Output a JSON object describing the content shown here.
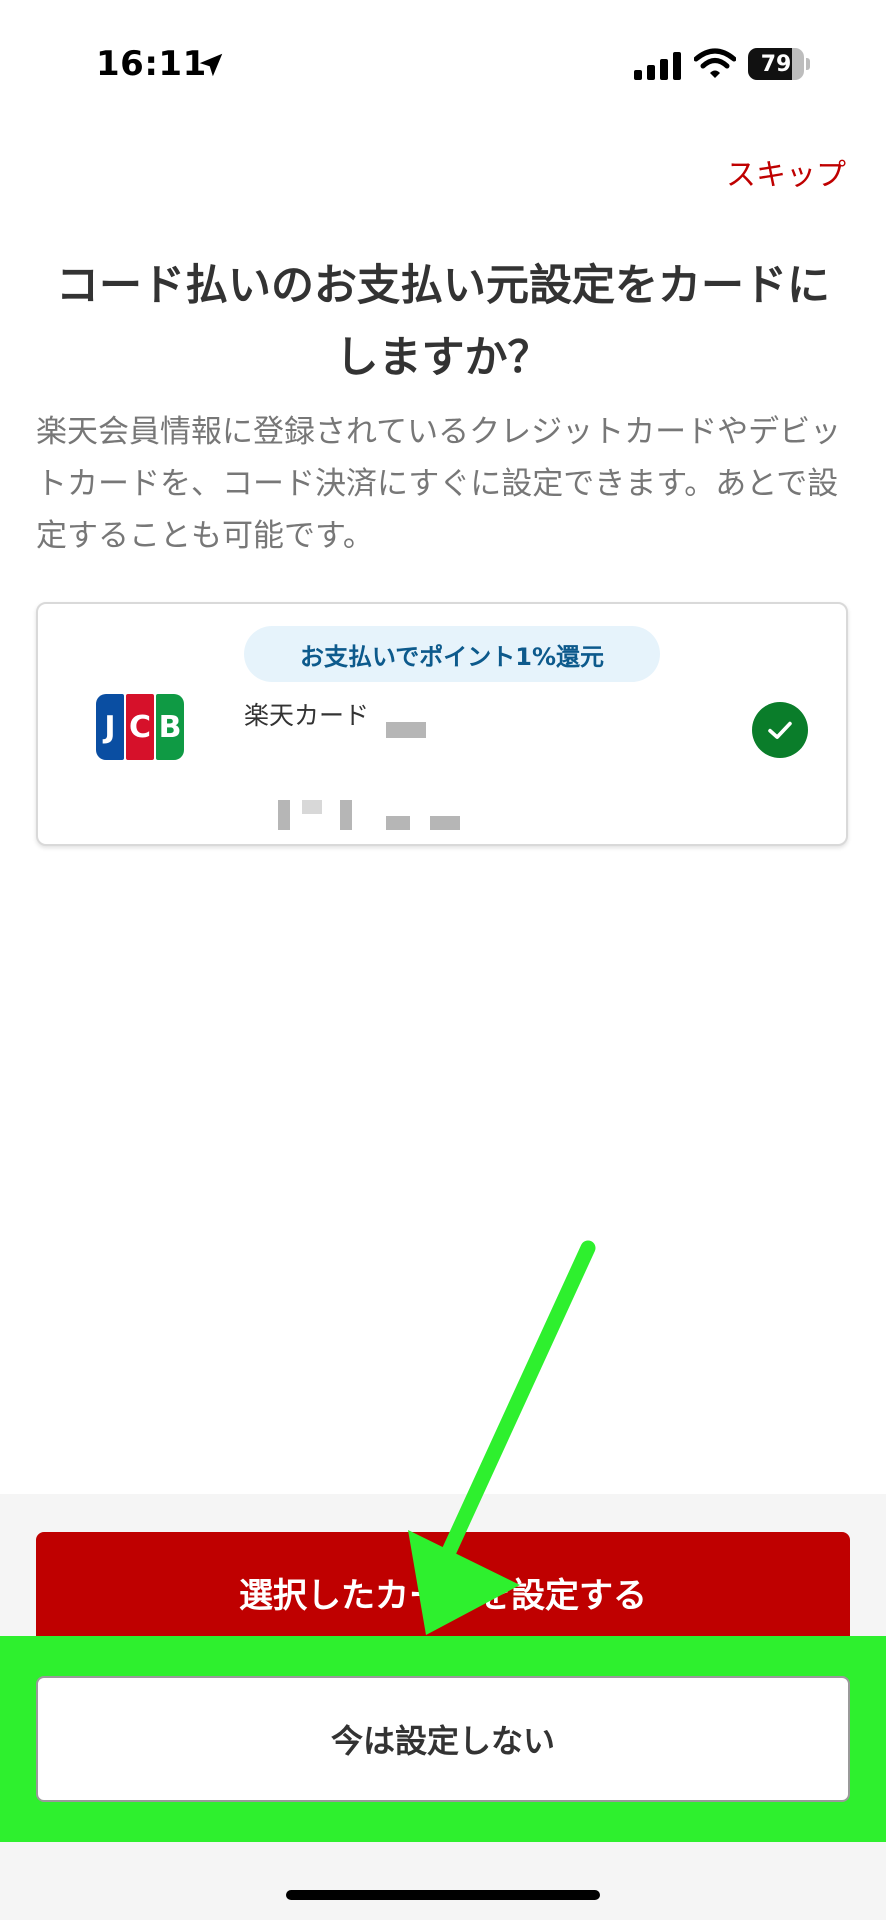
{
  "status_bar": {
    "time": "16:11",
    "battery": "79"
  },
  "header": {
    "skip_label": "スキップ"
  },
  "content": {
    "title": "コード払いのお支払い元設定をカードにしますか？",
    "description": "楽天会員情報に登録されているクレジットカードやデビットカードを、コード決済にすぐに設定できます。あとで設定することも可能です。"
  },
  "card_option": {
    "badge": "お支払いでポイント1%還元",
    "card_name": "楽天カード",
    "brand_logo": "JCB",
    "selected": true
  },
  "footer": {
    "primary_label": "選択したカードを設定する",
    "secondary_label": "今は設定しない"
  },
  "colors": {
    "brand_red": "#bf0000",
    "highlight_green": "#2ef02e",
    "selected_check": "#0a7d2a"
  },
  "icons": {
    "location": "location-arrow-icon",
    "signal": "cellular-signal-icon",
    "wifi": "wifi-icon",
    "battery": "battery-icon",
    "check": "check-icon",
    "annotation_arrow": "green-arrow-icon"
  }
}
